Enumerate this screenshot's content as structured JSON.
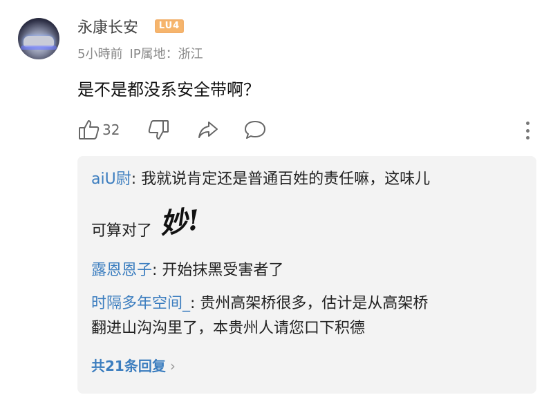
{
  "comment": {
    "username": "永康长安",
    "level": "LU4",
    "time": "5小時前",
    "ip_location": "IP属地：浙江",
    "text": "是不是都没系安全带啊？",
    "likes": "32"
  },
  "replies": [
    {
      "name": "aiU尉",
      "sep": ": ",
      "text_line1": "我就说肯定还是普通百姓的责任嘛，这味儿",
      "text_line2": "可算对了",
      "sticker": "妙!"
    },
    {
      "name": "露恩恩子",
      "sep": ": ",
      "text": "开始抹黑受害者了"
    },
    {
      "name": "时隔多年空间_",
      "sep": ": ",
      "text_line1": "贵州高架桥很多，估计是从高架桥",
      "text_line2": "翻进山沟沟里了，本贵州人请您口下积德"
    }
  ],
  "more_replies": "共21条回复",
  "colors": {
    "link": "#3b7dbf",
    "level_badge": "#f6b56c",
    "reply_bg": "#f3f3f3"
  }
}
